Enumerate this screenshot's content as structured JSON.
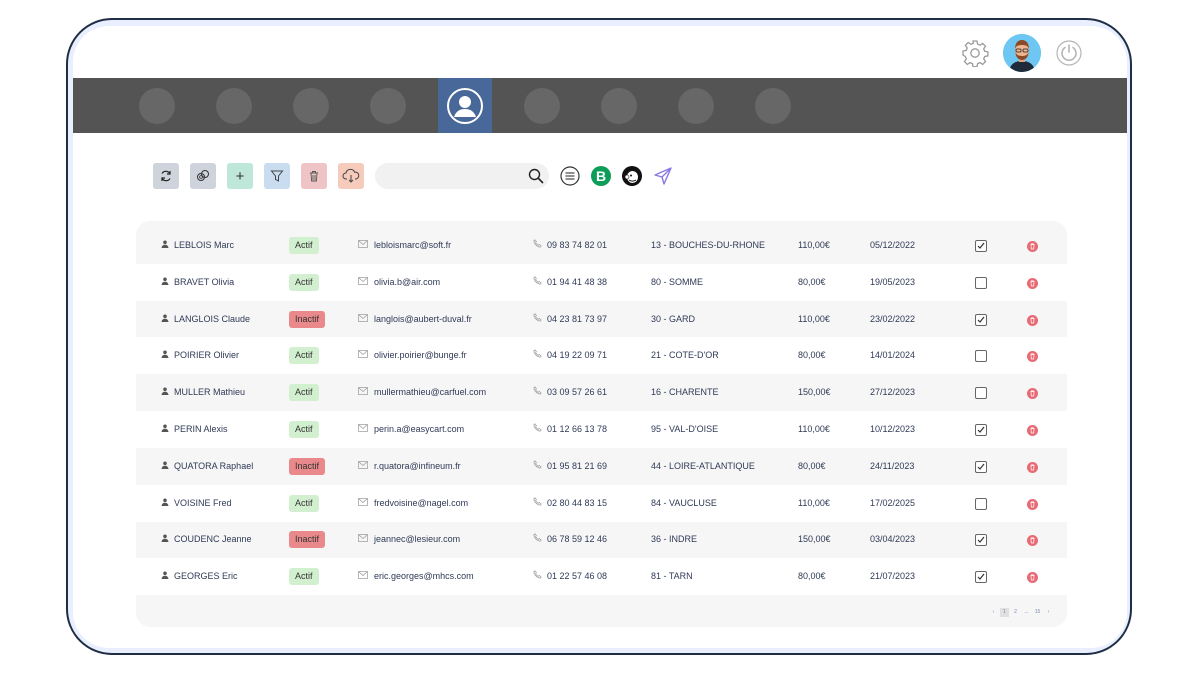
{
  "header": {
    "icons": [
      "gear-icon",
      "user-avatar",
      "power-icon"
    ]
  },
  "nav": {
    "active_icon": "user-circle-icon"
  },
  "toolbar": {
    "buttons": [
      {
        "name": "refresh-button",
        "icon": "refresh-icon",
        "color": "#cfd3db"
      },
      {
        "name": "link-button",
        "icon": "link-icon",
        "color": "#cfd3db"
      },
      {
        "name": "add-button",
        "icon": "plus-icon",
        "label": "+",
        "color": "#bfe7d9"
      },
      {
        "name": "filter-button",
        "icon": "filter-icon",
        "color": "#c9dcf0"
      },
      {
        "name": "delete-button",
        "icon": "trash-icon",
        "color": "#efc4c6"
      },
      {
        "name": "download-button",
        "icon": "cloud-download-icon",
        "color": "#f6cbbb"
      }
    ],
    "search": {
      "placeholder": "",
      "value": ""
    },
    "extra_icons": [
      "list-icon",
      "b-logo-icon",
      "mailchimp-icon",
      "send-icon"
    ],
    "b_logo_letter": "B"
  },
  "table": {
    "rows": [
      {
        "name": "LEBLOIS Marc",
        "status": "Actif",
        "email": "lebloismarc@soft.fr",
        "phone": "09 83 74 82 01",
        "dept": "13 - BOUCHES-DU-RHONE",
        "amount": "110,00€",
        "date": "05/12/2022",
        "checked": true
      },
      {
        "name": "BRAVET Olivia",
        "status": "Actif",
        "email": "olivia.b@air.com",
        "phone": "01 94 41 48 38",
        "dept": "80 - SOMME",
        "amount": "80,00€",
        "date": "19/05/2023",
        "checked": false
      },
      {
        "name": "LANGLOIS Claude",
        "status": "Inactif",
        "email": "langlois@aubert-duval.fr",
        "phone": "04 23 81 73 97",
        "dept": "30 - GARD",
        "amount": "110,00€",
        "date": "23/02/2022",
        "checked": true
      },
      {
        "name": "POIRIER Olivier",
        "status": "Actif",
        "email": "olivier.poirier@bunge.fr",
        "phone": "04 19 22 09 71",
        "dept": "21 - COTE-D'OR",
        "amount": "80,00€",
        "date": "14/01/2024",
        "checked": false
      },
      {
        "name": "MULLER Mathieu",
        "status": "Actif",
        "email": "mullermathieu@carfuel.com",
        "phone": "03 09 57 26 61",
        "dept": "16 - CHARENTE",
        "amount": "150,00€",
        "date": "27/12/2023",
        "checked": false
      },
      {
        "name": "PERIN Alexis",
        "status": "Actif",
        "email": "perin.a@easycart.com",
        "phone": "01 12 66 13 78",
        "dept": "95 - VAL-D'OISE",
        "amount": "110,00€",
        "date": "10/12/2023",
        "checked": true
      },
      {
        "name": "QUATORA Raphael",
        "status": "Inactif",
        "email": "r.quatora@infineum.fr",
        "phone": "01 95 81 21 69",
        "dept": "44 - LOIRE-ATLANTIQUE",
        "amount": "80,00€",
        "date": "24/11/2023",
        "checked": true
      },
      {
        "name": "VOISINE Fred",
        "status": "Actif",
        "email": "fredvoisine@nagel.com",
        "phone": "02 80 44 83 15",
        "dept": "84 - VAUCLUSE",
        "amount": "110,00€",
        "date": "17/02/2025",
        "checked": false
      },
      {
        "name": "COUDENC Jeanne",
        "status": "Inactif",
        "email": "jeannec@lesieur.com",
        "phone": "06 78 59 12 46",
        "dept": "36 - INDRE",
        "amount": "150,00€",
        "date": "03/04/2023",
        "checked": true
      },
      {
        "name": "GEORGES Eric",
        "status": "Actif",
        "email": "eric.georges@mhcs.com",
        "phone": "01 22 57 46 08",
        "dept": "81 - TARN",
        "amount": "80,00€",
        "date": "21/07/2023",
        "checked": true
      }
    ]
  },
  "pagination": {
    "prev": "‹",
    "pages": [
      "1",
      "2",
      "...",
      "15"
    ],
    "next": "›",
    "current": "1"
  },
  "colors": {
    "nav_bg": "#545454",
    "nav_active": "#48689a",
    "actif_badge": "#d2f0cf",
    "inactif_badge": "#e9898b",
    "delete": "#e86a74"
  }
}
